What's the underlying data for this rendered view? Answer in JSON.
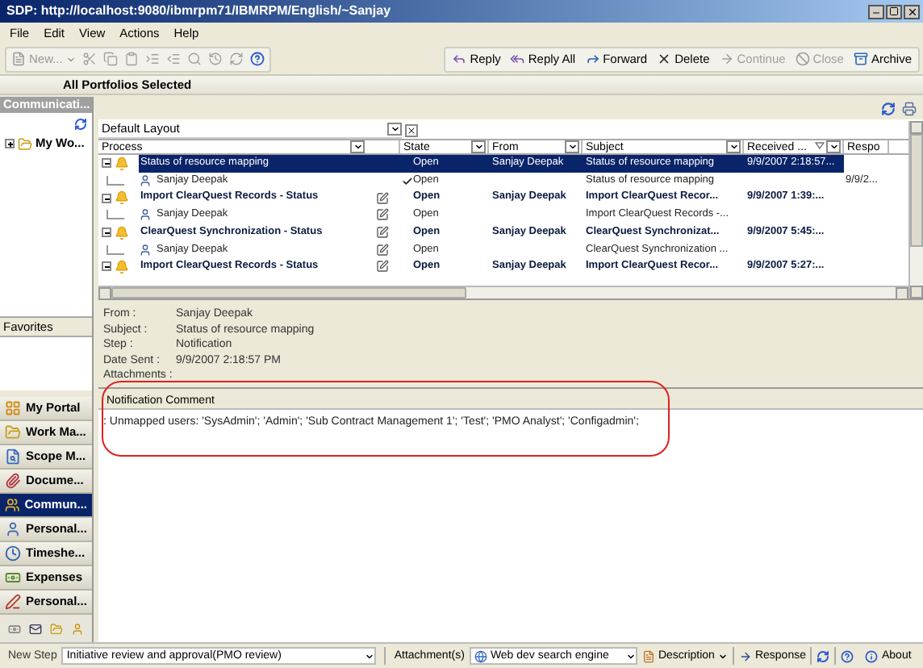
{
  "window": {
    "title": "SDP: http://localhost:9080/ibmrpm71/IBMRPM/English/~Sanjay"
  },
  "menu": [
    "File",
    "Edit",
    "View",
    "Actions",
    "Help"
  ],
  "toolbar": {
    "new_button": {
      "label": "New...",
      "disabled": true
    },
    "tools": [
      {
        "kind": "cut",
        "disabled": true
      },
      {
        "kind": "copy",
        "disabled": true
      },
      {
        "kind": "paste",
        "disabled": true
      },
      {
        "kind": "indent",
        "disabled": true
      },
      {
        "kind": "outdent",
        "disabled": true
      },
      {
        "kind": "find",
        "disabled": true
      },
      {
        "kind": "history",
        "disabled": true
      },
      {
        "kind": "refresh",
        "disabled": true
      },
      {
        "kind": "help",
        "disabled": false
      }
    ],
    "actions": [
      {
        "kind": "reply",
        "label": "Reply",
        "disabled": false
      },
      {
        "kind": "reply_all",
        "label": "Reply All",
        "disabled": false
      },
      {
        "kind": "forward",
        "label": "Forward",
        "disabled": false
      },
      {
        "kind": "delete",
        "label": "Delete",
        "disabled": false
      },
      {
        "kind": "continue",
        "label": "Continue",
        "disabled": true
      },
      {
        "kind": "close",
        "label": "Close",
        "disabled": true
      },
      {
        "kind": "archive",
        "label": "Archive",
        "disabled": false
      }
    ]
  },
  "portfolio_header": "All Portfolios Selected",
  "sidebar": {
    "title": "Communicati...",
    "tree": [
      {
        "label": "My Wo...",
        "expanded": false
      }
    ],
    "favorites_label": "Favorites",
    "nav": [
      {
        "kind": "portal",
        "label": "My Portal",
        "selected": false
      },
      {
        "kind": "work",
        "label": "Work Ma...",
        "selected": false
      },
      {
        "kind": "scope",
        "label": "Scope M...",
        "selected": false
      },
      {
        "kind": "document",
        "label": "Docume...",
        "selected": false
      },
      {
        "kind": "communication",
        "label": "Commun...",
        "selected": true
      },
      {
        "kind": "personal",
        "label": "Personal...",
        "selected": false
      },
      {
        "kind": "timesheet",
        "label": "Timeshe...",
        "selected": false
      },
      {
        "kind": "expenses",
        "label": "Expenses",
        "selected": false
      },
      {
        "kind": "personal_task",
        "label": "Personal...",
        "selected": false
      }
    ]
  },
  "grid": {
    "layout": "Default Layout",
    "columns": [
      "Process",
      "State",
      "From",
      "Subject",
      "Received ...",
      "Respo"
    ],
    "rows": [
      {
        "kind": "message",
        "expanded": true,
        "selected": true,
        "unread": false,
        "edit_icon": false,
        "process": "Status of resource mapping",
        "state": "Open",
        "from": "Sanjay Deepak",
        "subject": "Status of resource mapping",
        "received": "9/9/2007 2:18:57..."
      },
      {
        "kind": "recipient",
        "checked": true,
        "edit_icon": false,
        "process": "Sanjay Deepak",
        "state": "Open",
        "subject": "Status of resource mapping",
        "response": "9/9/2..."
      },
      {
        "kind": "message",
        "expanded": true,
        "selected": false,
        "unread": true,
        "edit_icon": true,
        "process": "Import ClearQuest Records - Status",
        "state": "Open",
        "from": "Sanjay Deepak",
        "subject": "Import ClearQuest Recor...",
        "received": "9/9/2007 1:39:..."
      },
      {
        "kind": "recipient",
        "checked": false,
        "edit_icon": true,
        "process": "Sanjay Deepak",
        "state": "Open",
        "subject": "Import ClearQuest Records -..."
      },
      {
        "kind": "message",
        "expanded": true,
        "selected": false,
        "unread": true,
        "edit_icon": true,
        "process": "ClearQuest Synchronization - Status",
        "state": "Open",
        "from": "Sanjay Deepak",
        "subject": "ClearQuest Synchronizat...",
        "received": "9/9/2007 5:45:..."
      },
      {
        "kind": "recipient",
        "checked": false,
        "edit_icon": true,
        "process": "Sanjay Deepak",
        "state": "Open",
        "subject": "ClearQuest Synchronization ..."
      },
      {
        "kind": "message",
        "expanded": true,
        "selected": false,
        "unread": true,
        "edit_icon": true,
        "process": "Import ClearQuest Records - Status",
        "state": "Open",
        "from": "Sanjay Deepak",
        "subject": "Import ClearQuest Recor...",
        "received": "9/9/2007 5:27:..."
      }
    ]
  },
  "details": {
    "fields": [
      {
        "label": "From :",
        "value": "Sanjay Deepak"
      },
      {
        "label": "Subject :",
        "value": "Status of resource mapping"
      },
      {
        "label": "Step :",
        "value": "Notification"
      },
      {
        "label": "Date Sent :",
        "value": "9/9/2007 2:18:57 PM"
      },
      {
        "label": "Attachments :"
      }
    ]
  },
  "comment": {
    "title": "Notification Comment",
    "text": ": Unmapped users: 'SysAdmin'; 'Admin'; 'Sub Contract Management 1'; 'Test'; 'PMO Analyst'; 'Configadmin';"
  },
  "status_bar": {
    "new_step_label": "New Step",
    "new_step_value": "Initiative review and approval(PMO review)",
    "attachments_label": "Attachment(s)",
    "attachment_value": "Web dev search engine",
    "description": "Description",
    "response": "Response",
    "about": "About"
  }
}
